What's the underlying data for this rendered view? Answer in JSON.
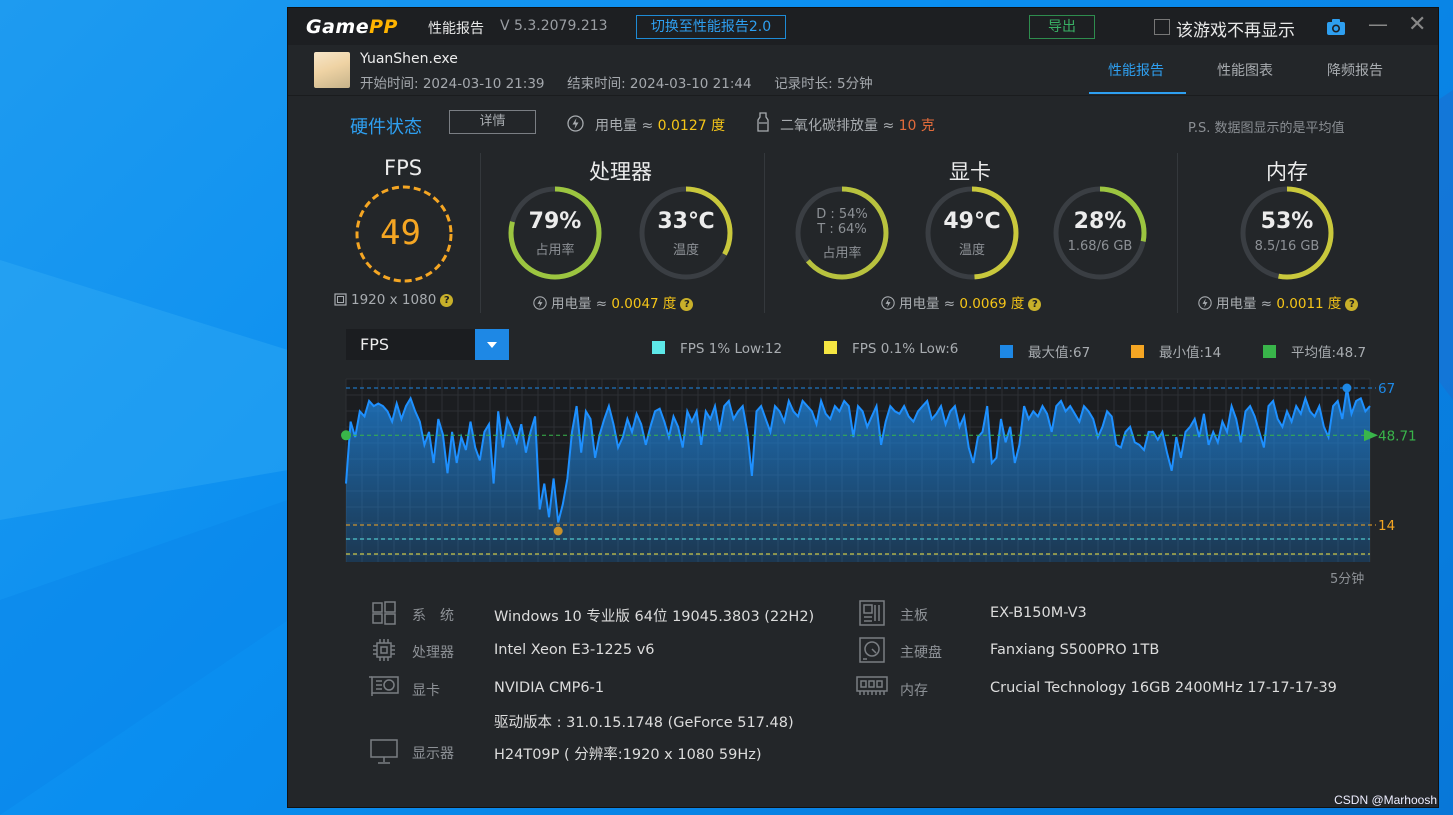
{
  "app": {
    "logo_game": "Game",
    "logo_pp": "PP",
    "title": "性能报告",
    "version": "V 5.3.2079.213",
    "switch_label": "切换至性能报告2.0",
    "export_label": "导出",
    "hide_label": "该游戏不再显示",
    "colors": {
      "accent": "#2e9ff0",
      "yellow": "#f5c518",
      "fps": "#f5a623",
      "green": "#39b065"
    }
  },
  "session": {
    "process": "YuanShen.exe",
    "start_label": "开始时间: 2024-03-10 21:39",
    "end_label": "结束时间: 2024-03-10 21:44",
    "duration_label": "记录时长: 5分钟"
  },
  "tabs": [
    {
      "label": "性能报告",
      "active": true
    },
    {
      "label": "性能图表",
      "active": false
    },
    {
      "label": "降频报告",
      "active": false
    }
  ],
  "hardware": {
    "title": "硬件状态",
    "detail_button": "详情",
    "power_label": "用电量 ≈ ",
    "power_value": "0.0127 度",
    "co2_label": "二氧化碳排放量 ≈ ",
    "co2_value": "10 克",
    "note": "P.S. 数据图显示的是平均值"
  },
  "fps_panel": {
    "title": "FPS",
    "value": "49",
    "resolution": "1920 x 1080"
  },
  "cpu_panel": {
    "title": "处理器",
    "usage_value": "79%",
    "usage_fraction": 0.79,
    "usage_label": "占用率",
    "temp_value": "33℃",
    "temp_fraction": 0.33,
    "temp_label": "温度",
    "power_label": "用电量 ≈ ",
    "power_value": "0.0047 度"
  },
  "gpu_panel": {
    "title": "显卡",
    "d_usage": "D : 54%",
    "t_usage": "T : 64%",
    "usage_fraction": 0.64,
    "usage_label": "占用率",
    "temp_value": "49℃",
    "temp_fraction": 0.49,
    "temp_label": "温度",
    "vram_value": "28%",
    "vram_fraction": 0.28,
    "vram_label": "1.68/6 GB",
    "power_label": "用电量 ≈ ",
    "power_value": "0.0069 度"
  },
  "mem_panel": {
    "title": "内存",
    "value": "53%",
    "fraction": 0.53,
    "label": "8.5/16 GB",
    "power_label": "用电量 ≈ ",
    "power_value": "0.0011 度"
  },
  "chart_controls": {
    "metric": "FPS",
    "legend": [
      {
        "label": "FPS 1% Low:12",
        "color": "#5de8e8"
      },
      {
        "label": "FPS 0.1% Low:6",
        "color": "#f5e642"
      },
      {
        "label": "最大值:67",
        "color": "#1e88e5"
      },
      {
        "label": "最小值:14",
        "color": "#f5a623"
      },
      {
        "label": "平均值:48.7",
        "color": "#39b54a"
      }
    ]
  },
  "chart_data": {
    "type": "area",
    "series": [
      {
        "name": "FPS",
        "values": [
          30,
          54,
          48,
          58,
          56,
          62,
          60,
          61,
          60,
          58,
          54,
          61,
          55,
          60,
          63,
          58,
          54,
          45,
          50,
          38,
          55,
          49,
          34,
          50,
          38,
          48,
          43,
          54,
          44,
          39,
          50,
          53,
          30,
          58,
          44,
          55,
          51,
          46,
          53,
          42,
          50,
          56,
          20,
          30,
          17,
          32,
          15,
          22,
          32,
          50,
          60,
          42,
          58,
          55,
          40,
          49,
          55,
          60,
          53,
          44,
          48,
          55,
          50,
          57,
          53,
          45,
          52,
          58,
          59,
          54,
          48,
          56,
          52,
          44,
          58,
          54,
          58,
          45,
          58,
          55,
          60,
          50,
          60,
          62,
          55,
          58,
          60,
          50,
          33,
          58,
          60,
          55,
          50,
          60,
          58,
          54,
          62,
          58,
          56,
          62,
          60,
          58,
          53,
          62,
          57,
          55,
          60,
          58,
          62,
          60,
          48,
          60,
          58,
          52,
          56,
          60,
          45,
          54,
          60,
          58,
          57,
          60,
          56,
          54,
          58,
          60,
          62,
          55,
          57,
          60,
          53,
          58,
          60,
          52,
          56,
          44,
          38,
          48,
          50,
          60,
          38,
          40,
          55,
          46,
          52,
          38,
          45,
          60,
          55,
          58,
          56,
          60,
          57,
          50,
          60,
          62,
          58,
          60,
          57,
          54,
          60,
          58,
          55,
          48,
          52,
          58,
          56,
          45,
          44,
          50,
          52,
          46,
          45,
          43,
          50,
          50,
          47,
          50,
          42,
          35,
          48,
          40,
          50,
          52,
          55,
          48,
          57,
          45,
          50,
          46,
          54,
          50,
          60,
          55,
          46,
          58,
          60,
          56,
          50,
          44,
          60,
          62,
          55,
          52,
          58,
          54,
          60,
          57,
          63,
          58,
          56,
          60,
          52,
          48,
          60,
          62,
          55,
          67,
          57,
          62,
          63,
          58,
          60
        ]
      }
    ],
    "max": 67,
    "min": 14,
    "average": 48.71,
    "one_percent_low": 12,
    "point_one_percent_low": 6,
    "x_label": "5分钟",
    "right_labels": [
      "67",
      "48.71",
      "14"
    ]
  },
  "system": {
    "os_label": "系　统",
    "os_value": "Windows 10 专业版 64位 19045.3803 (22H2)",
    "cpu_label": "处理器",
    "cpu_value": "Intel Xeon E3-1225 v6",
    "gpu_label": "显卡",
    "gpu_value": "NVIDIA CMP6-1",
    "driver_value": "驱动版本 : 31.0.15.1748 (GeForce 517.48)",
    "monitor_label": "显示器",
    "monitor_value": "H24T09P ( 分辨率:1920 x 1080 59Hz)",
    "board_label": "主板",
    "board_value": "EX-B150M-V3",
    "disk_label": "主硬盘",
    "disk_value": "Fanxiang S500PRO 1TB",
    "mem_label": "内存",
    "mem_value": "Crucial Technology 16GB 2400MHz 17-17-17-39"
  },
  "watermark": "CSDN @Marhoosh"
}
